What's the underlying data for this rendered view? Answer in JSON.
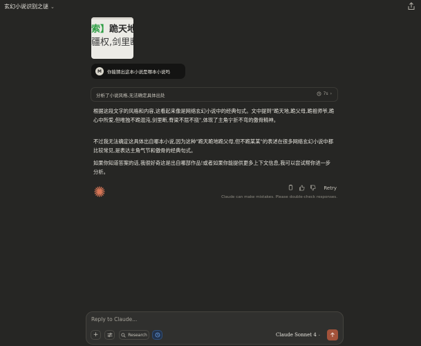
{
  "header": {
    "title": "玄幻小说识别之谜"
  },
  "attachment": {
    "line1_highlight": "索】",
    "line1_text": "跪天地,",
    "line2_text": "疆权,剑里断"
  },
  "user_message": {
    "avatar_initial": "M",
    "text": "你能猜出这本小说是哪本小说吗"
  },
  "thinking": {
    "summary": "分析了小说风格,无法确定具体出处",
    "duration": "7s"
  },
  "response": {
    "paragraphs": [
      "根据这段文字的风格和内容,这看起来像是网络玄幻小说中的经典句式。文中提到\"跪天地,跪父母,跪祖师爷,跪心中所爱,但唯独不跪混沌,剑里断,脊梁不屈不挠\",体现了主角宁折不弯的傲骨精神。",
      "不过我无法确定这具体出自哪本小说,因为这种\"跪天跪地跪父母,但不跪某某\"的表述在很多网络玄幻小说中都比较常见,是表达主角气节和傲骨的经典句式。",
      "如果你知道答案的话,我很好奇这是出自哪部作品!或者如果你能提供更多上下文信息,我可以尝试帮你进一步分析。"
    ]
  },
  "actions": {
    "retry_label": "Retry"
  },
  "disclaimer": "Claude can make mistakes. Please double-check responses.",
  "composer": {
    "placeholder": "Reply to Claude...",
    "research_label": "Research",
    "model_label": "Claude Sonnet 4"
  },
  "colors": {
    "accent": "#d97757",
    "send_button": "#a2523a",
    "background": "#262624"
  }
}
